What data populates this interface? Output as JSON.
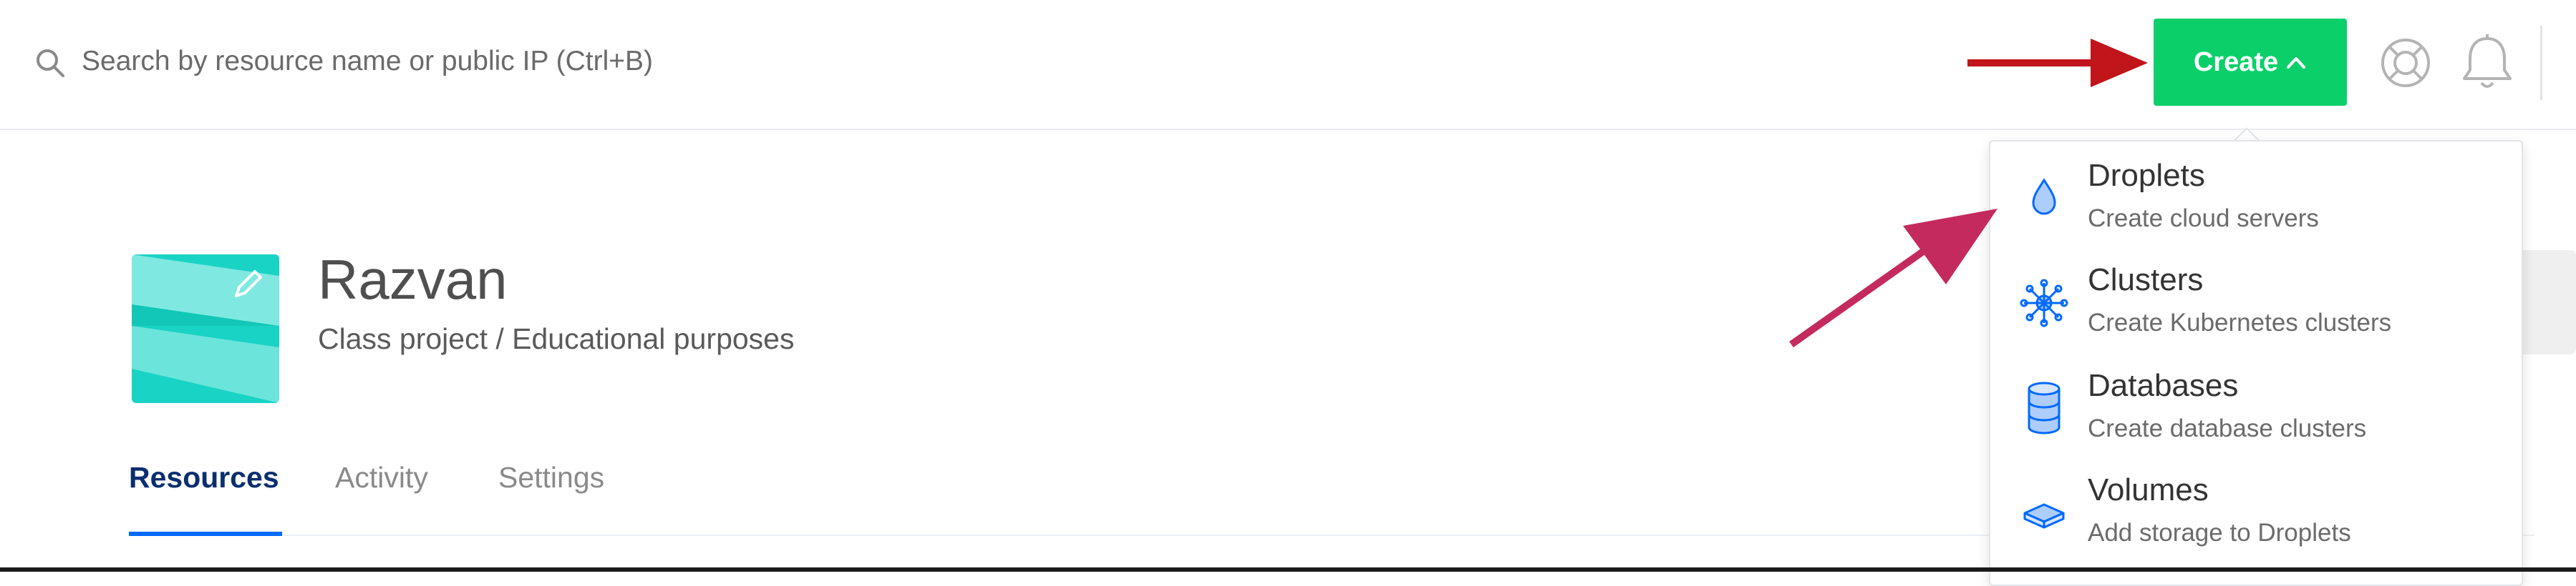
{
  "search": {
    "placeholder": "Search by resource name or public IP (Ctrl+B)"
  },
  "header": {
    "create_label": "Create"
  },
  "project": {
    "name": "Razvan",
    "description": "Class project / Educational purposes"
  },
  "tabs": [
    {
      "label": "Resources",
      "active": true
    },
    {
      "label": "Activity",
      "active": false
    },
    {
      "label": "Settings",
      "active": false
    }
  ],
  "create_menu": {
    "items": [
      {
        "title": "Droplets",
        "subtitle": "Create cloud servers",
        "icon": "droplet-icon"
      },
      {
        "title": "Clusters",
        "subtitle": "Create Kubernetes clusters",
        "icon": "kubernetes-icon"
      },
      {
        "title": "Databases",
        "subtitle": "Create database clusters",
        "icon": "database-icon"
      },
      {
        "title": "Volumes",
        "subtitle": "Add storage to Droplets",
        "icon": "volume-icon"
      }
    ]
  },
  "colors": {
    "accent_green": "#0bd06a",
    "tab_active": "#0b2e6e",
    "tab_underline": "#0069ff",
    "icon_blue": "#0069ff",
    "annotation_red": "#c0151b",
    "annotation_magenta": "#c42a5e",
    "logo_teal": "#19d3c5"
  }
}
